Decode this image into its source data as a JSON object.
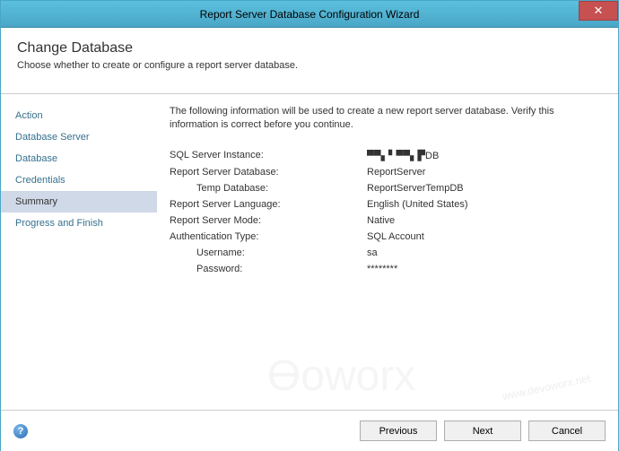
{
  "window": {
    "title": "Report Server Database Configuration Wizard"
  },
  "header": {
    "title": "Change Database",
    "subtitle": "Choose whether to create or configure a report server database."
  },
  "sidebar": {
    "items": [
      {
        "label": "Action",
        "selected": false
      },
      {
        "label": "Database Server",
        "selected": false
      },
      {
        "label": "Database",
        "selected": false
      },
      {
        "label": "Credentials",
        "selected": false
      },
      {
        "label": "Summary",
        "selected": true
      },
      {
        "label": "Progress and Finish",
        "selected": false
      }
    ]
  },
  "content": {
    "intro": "The following information will be used to create a new report server database. Verify this information is correct before you continue.",
    "summary": [
      {
        "label": "SQL Server Instance:",
        "value": "▀▀▖▘▀▀▖▛DB",
        "indent": false
      },
      {
        "label": "Report Server Database:",
        "value": "ReportServer",
        "indent": false
      },
      {
        "label": "Temp Database:",
        "value": "ReportServerTempDB",
        "indent": true
      },
      {
        "label": "Report Server Language:",
        "value": "English (United States)",
        "indent": false
      },
      {
        "label": "Report Server Mode:",
        "value": "Native",
        "indent": false
      },
      {
        "label": "Authentication Type:",
        "value": "SQL Account",
        "indent": false
      },
      {
        "label": "Username:",
        "value": "sa",
        "indent": true
      },
      {
        "label": "Password:",
        "value": "********",
        "indent": true
      }
    ]
  },
  "footer": {
    "help_symbol": "?",
    "previous": "Previous",
    "next": "Next",
    "cancel": "Cancel"
  },
  "watermark": {
    "logo": "Ɵoworx",
    "url": "www.devoworx.net"
  }
}
